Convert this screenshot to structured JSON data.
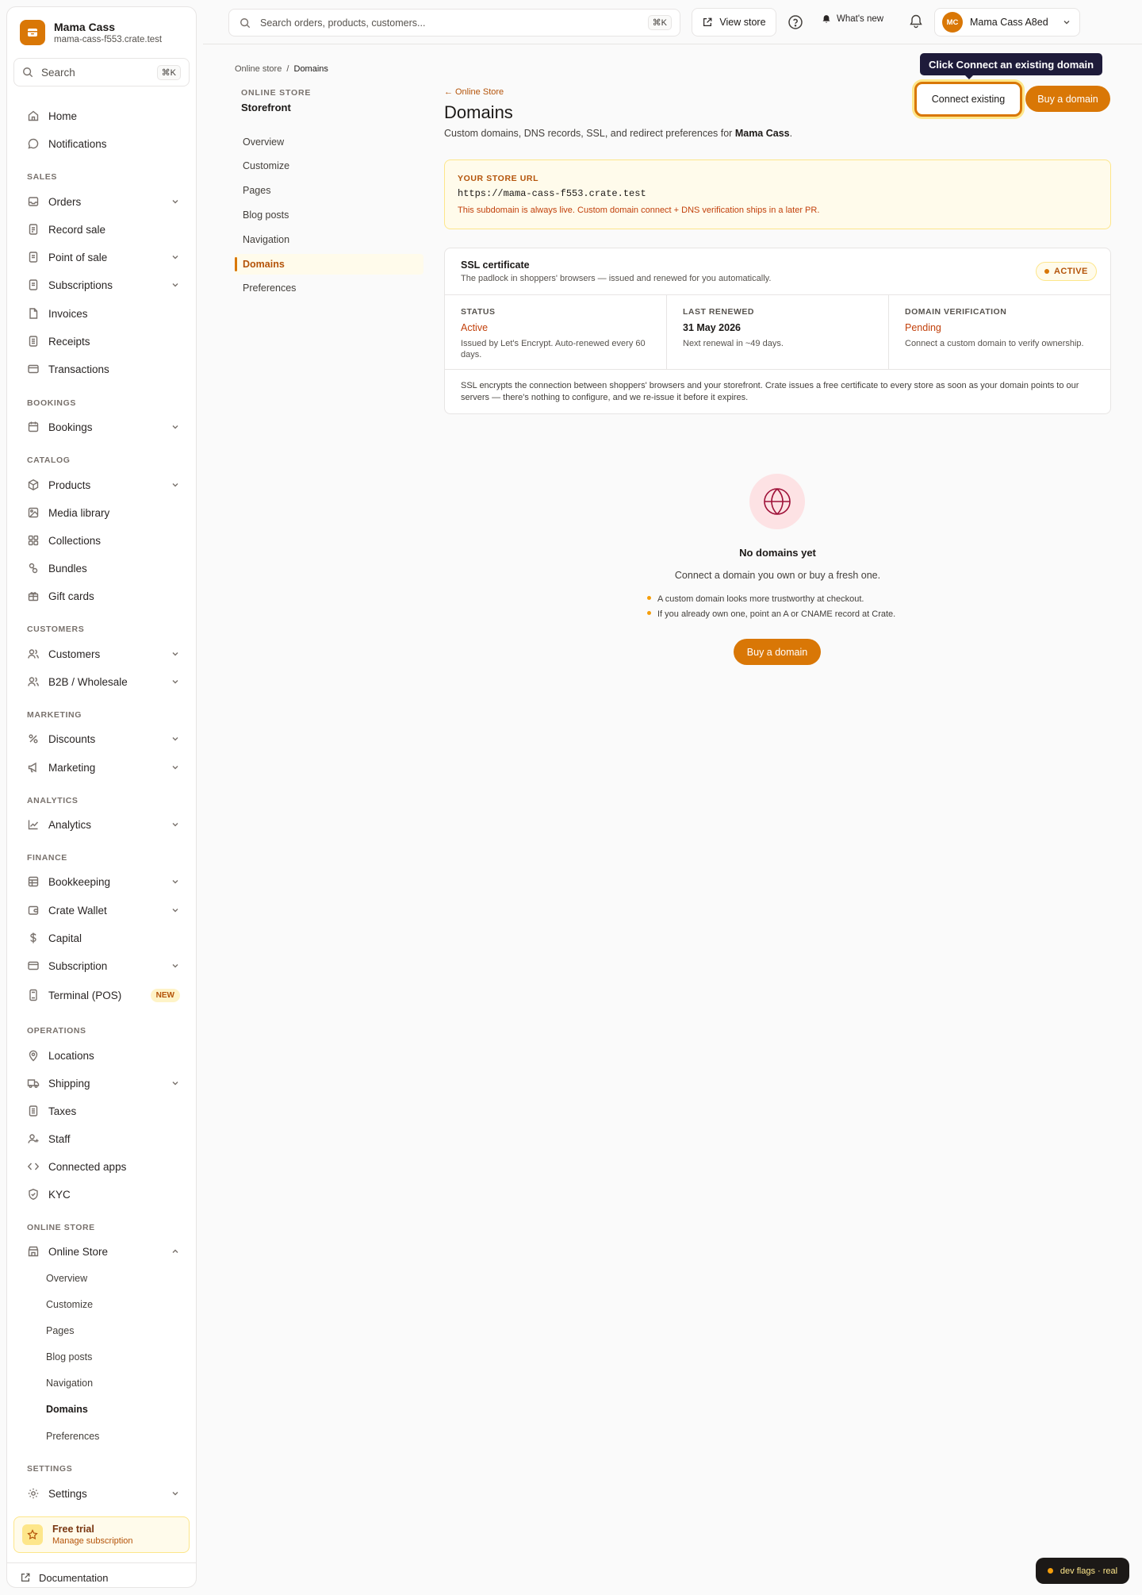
{
  "brand": {
    "name": "Mama Cass",
    "domain": "mama-cass-f553.crate.test",
    "accent": "#d97706"
  },
  "sidebar": {
    "search_placeholder": "Search",
    "search_shortcut": "⌘K",
    "items": [
      {
        "label": "Home"
      },
      {
        "label": "Notifications"
      },
      {
        "label": "Orders"
      },
      {
        "label": "Record sale"
      },
      {
        "label": "Point of sale"
      },
      {
        "label": "Subscriptions"
      },
      {
        "label": "Invoices"
      },
      {
        "label": "Receipts"
      },
      {
        "label": "Transactions"
      },
      {
        "label": "Bookings"
      },
      {
        "label": "Products"
      },
      {
        "label": "Media library"
      },
      {
        "label": "Collections"
      },
      {
        "label": "Bundles"
      },
      {
        "label": "Gift cards"
      },
      {
        "label": "Customers"
      },
      {
        "label": "B2B / Wholesale"
      },
      {
        "label": "Discounts"
      },
      {
        "label": "Marketing"
      },
      {
        "label": "Analytics"
      },
      {
        "label": "Bookkeeping"
      },
      {
        "label": "Crate Wallet"
      },
      {
        "label": "Capital"
      },
      {
        "label": "Subscription"
      },
      {
        "label": "Terminal (POS)",
        "badge": "NEW"
      },
      {
        "label": "Locations"
      },
      {
        "label": "Shipping"
      },
      {
        "label": "Taxes"
      },
      {
        "label": "Staff"
      },
      {
        "label": "Connected apps"
      },
      {
        "label": "KYC"
      },
      {
        "label": "Online Store"
      },
      {
        "label": "Settings"
      }
    ],
    "sections": [
      "SALES",
      "BOOKINGS",
      "CATALOG",
      "CUSTOMERS",
      "MARKETING",
      "ANALYTICS",
      "FINANCE",
      "OPERATIONS",
      "ONLINE STORE",
      "SETTINGS"
    ],
    "online_store_subitems": [
      "Overview",
      "Customize",
      "Pages",
      "Blog posts",
      "Navigation",
      "Domains",
      "Preferences"
    ],
    "active_subitem": "Domains",
    "trial": {
      "title": "Free trial",
      "link": "Manage subscription"
    },
    "documentation": "Documentation"
  },
  "topbar": {
    "search_placeholder": "Search orders, products, customers...",
    "search_shortcut": "⌘K",
    "view_store": "View store",
    "whats_new": "What's new",
    "account_initials": "MC",
    "account_name": "Mama Cass A8ed"
  },
  "breadcrumb": {
    "parent": "Online store",
    "separator": "/",
    "current": "Domains"
  },
  "subnav": {
    "eyebrow": "ONLINE STORE",
    "title": "Storefront",
    "items": [
      "Overview",
      "Customize",
      "Pages",
      "Blog posts",
      "Navigation",
      "Domains",
      "Preferences"
    ],
    "active": "Domains"
  },
  "main": {
    "back_link": "Online Store",
    "title": "Domains",
    "description_prefix": "Custom domains, DNS records, SSL, and redirect preferences for ",
    "description_store": "Mama Cass",
    "description_suffix": ".",
    "tooltip": "Click Connect an existing domain",
    "connect_button": "Connect existing",
    "buy_button": "Buy a domain"
  },
  "store_url": {
    "eyebrow": "YOUR STORE URL",
    "url": "https://mama-cass-f553.crate.test",
    "note": "This subdomain is always live. Custom domain connect + DNS verification ships in a later PR."
  },
  "ssl": {
    "title": "SSL certificate",
    "subtitle": "The padlock in shoppers' browsers — issued and renewed for you automatically.",
    "badge": "ACTIVE",
    "columns": [
      {
        "label": "STATUS",
        "value": "Active",
        "note": "Issued by Let's Encrypt. Auto-renewed every 60 days."
      },
      {
        "label": "LAST RENEWED",
        "value": "31 May 2026",
        "note": "Next renewal in ~49 days."
      },
      {
        "label": "DOMAIN VERIFICATION",
        "value": "Pending",
        "note": "Connect a custom domain to verify ownership."
      }
    ],
    "footer": "SSL encrypts the connection between shoppers' browsers and your storefront. Crate issues a free certificate to every store as soon as your domain points to our servers — there's nothing to configure, and we re-issue it before it expires."
  },
  "empty_state": {
    "icon": "globe-icon",
    "title": "No domains yet",
    "subtitle": "Connect a domain you own or buy a fresh one.",
    "tips": [
      "A custom domain looks more trustworthy at checkout.",
      "If you already own one, point an A or CNAME record at Crate."
    ],
    "button": "Buy a domain"
  },
  "dev_flags": "dev flags · real"
}
